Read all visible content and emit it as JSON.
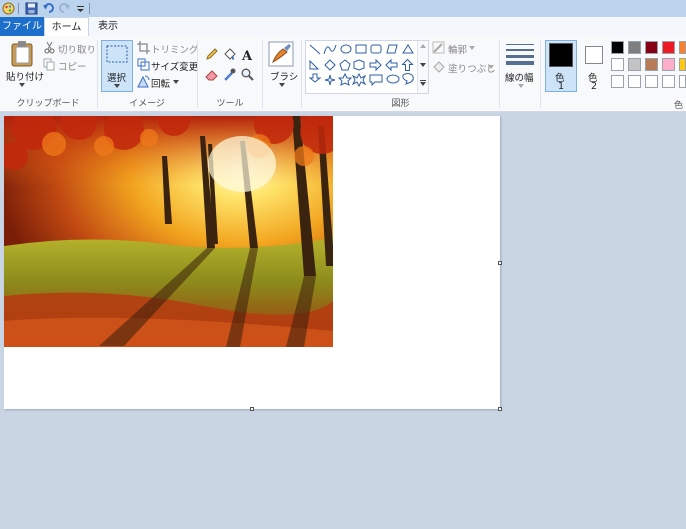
{
  "tabs": {
    "file": "ファイル",
    "home": "ホーム",
    "view": "表示"
  },
  "clipboard": {
    "paste": "貼り付け",
    "cut": "切り取り",
    "copy": "コピー",
    "label": "クリップボード"
  },
  "image": {
    "select": "選択",
    "crop": "トリミング",
    "resize": "サイズ変更",
    "rotate": "回転",
    "label": "イメージ"
  },
  "tools": {
    "label": "ツール"
  },
  "brushes": {
    "label": "ブラシ"
  },
  "shapes": {
    "outline": "輪郭",
    "fill": "塗りつぶし",
    "label": "図形"
  },
  "size": {
    "label": "線の幅"
  },
  "colors": {
    "color1": "色",
    "color1_num": "1",
    "color2": "色",
    "color2_num": "2",
    "label": "色",
    "selected_color1": "#000000",
    "selected_color2": "#ffffff",
    "palette_row1": [
      "#000000",
      "#7f7f7f",
      "#880015",
      "#ed1c24",
      "#ff7f27"
    ],
    "palette_row2": [
      "#ffffff",
      "#c3c3c3",
      "#b97a57",
      "#ffaec9",
      "#ffc90e"
    ],
    "palette_row3": [
      "#ffffff",
      "#ffffff",
      "#ffffff",
      "#ffffff",
      "#ffffff"
    ]
  },
  "canvas": {
    "image_description_icon": "autumn-forest-photo"
  }
}
